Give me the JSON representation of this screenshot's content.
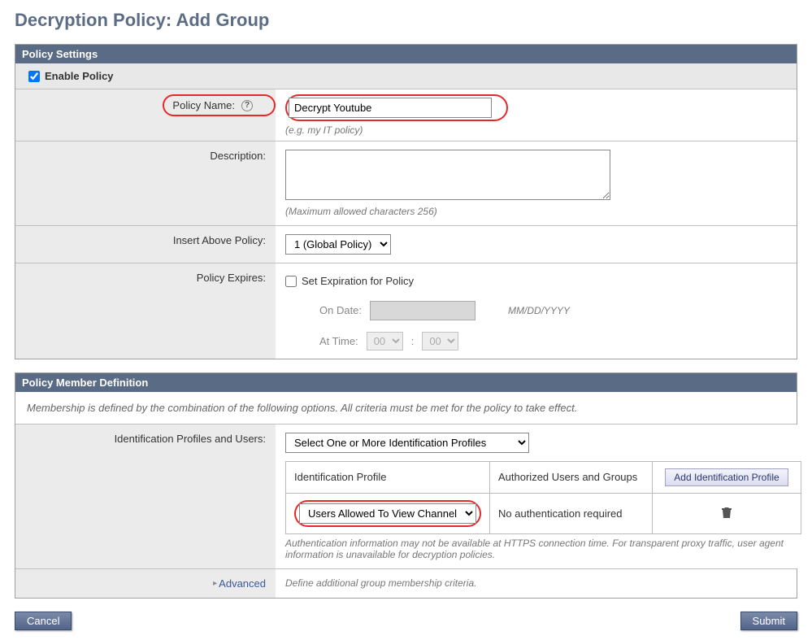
{
  "page_title": "Decryption Policy: Add Group",
  "sections": {
    "policy": {
      "header": "Policy Settings",
      "enable_label": "Enable Policy",
      "enable_checked": true,
      "name_label": "Policy Name:",
      "name_value": "Decrypt Youtube",
      "name_hint": "(e.g. my IT policy)",
      "desc_label": "Description:",
      "desc_value": "",
      "desc_hint": "(Maximum allowed characters 256)",
      "insert_label": "Insert Above Policy:",
      "insert_selected": "1 (Global Policy)",
      "expires_label": "Policy Expires:",
      "exp_checkbox_label": "Set Expiration for Policy",
      "exp_date_label": "On Date:",
      "exp_date_hint": "MM/DD/YYYY",
      "exp_time_label": "At Time:",
      "exp_hour": "00",
      "exp_min": "00"
    },
    "member": {
      "header": "Policy Member Definition",
      "note": "Membership is defined by the combination of the following options. All criteria must be met for the policy to take effect.",
      "id_label": "Identification Profiles and Users:",
      "id_select": "Select One or More Identification Profiles",
      "col_profile": "Identification Profile",
      "col_users": "Authorized Users and Groups",
      "add_btn": "Add Identification Profile",
      "row_profile_selected": "Users Allowed To View Channel",
      "row_users_text": "No authentication required",
      "auth_hint": "Authentication information may not be available at HTTPS connection time. For transparent proxy traffic, user agent information is unavailable for decryption policies.",
      "advanced_label": "Advanced",
      "advanced_text": "Define additional group membership criteria."
    }
  },
  "buttons": {
    "cancel": "Cancel",
    "submit": "Submit"
  }
}
